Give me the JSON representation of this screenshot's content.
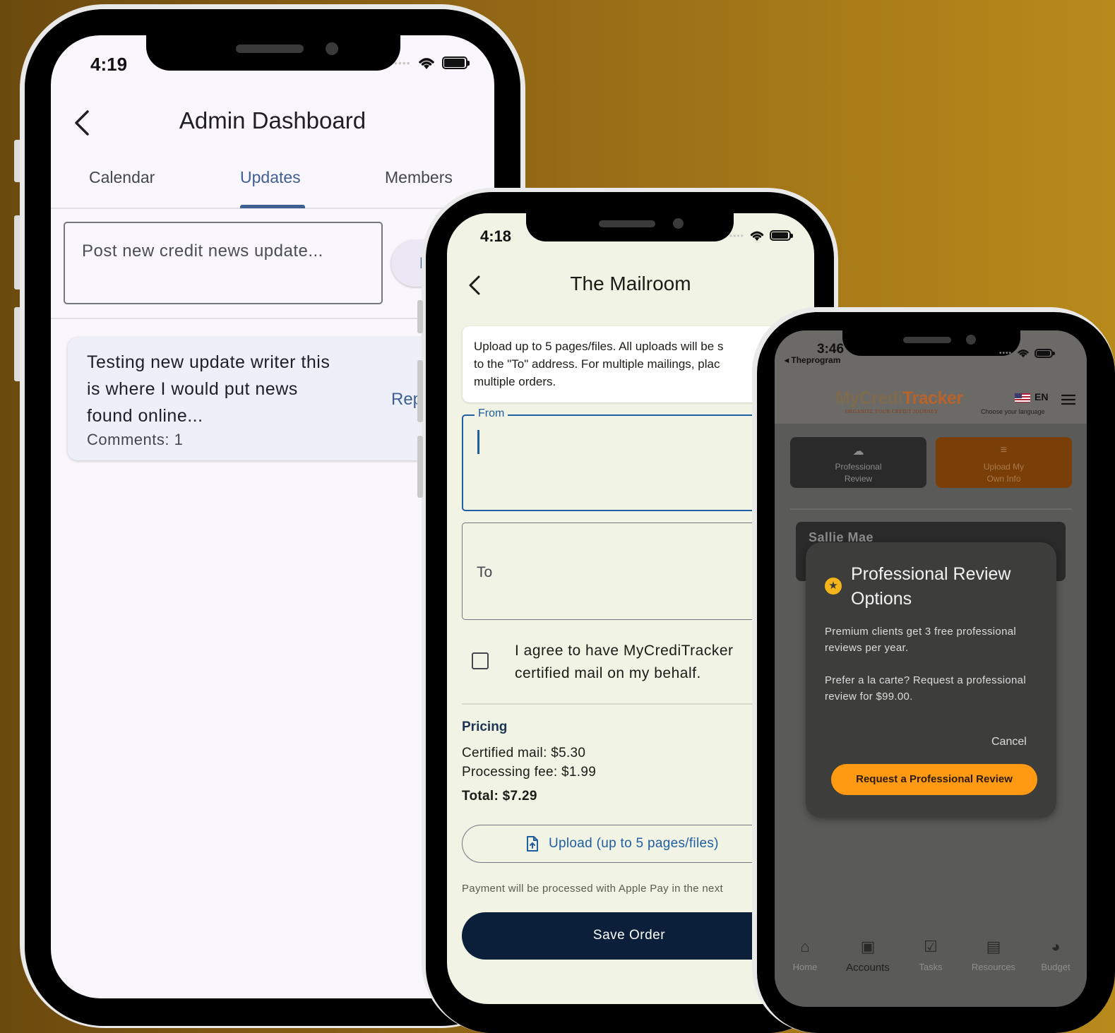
{
  "admin_phone": {
    "status_time": "4:19",
    "title": "Admin Dashboard",
    "tabs": [
      {
        "label": "Calendar",
        "active": false
      },
      {
        "label": "Updates",
        "active": true
      },
      {
        "label": "Members",
        "active": false
      }
    ],
    "post_input_placeholder": "Post new credit news update...",
    "post_button_label": "P",
    "update_card": {
      "text": "Testing new update writer this is where I would put news found online...",
      "comments": "Comments: 1",
      "reply_label": "Rep"
    }
  },
  "mailroom_phone": {
    "status_time": "4:18",
    "title": "The Mailroom",
    "info_text": "Upload up to 5 pages/files. All uploads will be s\nto the \"To\" address. For multiple mailings, plac\nmultiple orders.",
    "from_label": "From",
    "to_label": "To",
    "agree_text": "I agree to have MyCrediTracker certified mail on my behalf.",
    "agree_checked": false,
    "pricing_heading": "Pricing",
    "certified_mail": "Certified mail: $5.30",
    "processing_fee": "Processing fee: $1.99",
    "total": "Total: $7.29",
    "upload_button": "Upload (up to 5 pages/files)",
    "payment_note": "Payment will be processed with Apple Pay in the next",
    "save_button": "Save Order"
  },
  "creditracker_phone": {
    "status_time": "3:46",
    "back_app": "◂ Theprogram",
    "logo_part1": "MyCredi",
    "logo_part2": "Tracker",
    "tagline": "ORGANIZE YOUR CREDIT JOURNEY",
    "language_code": "EN",
    "language_caption": "Choose your language",
    "tiles": [
      {
        "label": "Professional\nReview",
        "icon": "cloud-upload-icon"
      },
      {
        "label": "Upload My\nOwn Info",
        "icon": "edit-list-icon"
      }
    ],
    "account_name": "Sallie Mae",
    "dialog": {
      "title": "Professional Review Options",
      "body1": "Premium clients get 3 free professional reviews per year.",
      "body2": "Prefer a la carte? Request a professional review for $99.00.",
      "cancel_label": "Cancel",
      "request_label": "Request a Professional Review"
    },
    "nav": [
      {
        "label": "Home",
        "icon": "home-icon",
        "active": false
      },
      {
        "label": "Accounts",
        "icon": "wallet-icon",
        "active": true
      },
      {
        "label": "Tasks",
        "icon": "checklist-icon",
        "active": false
      },
      {
        "label": "Resources",
        "icon": "book-icon",
        "active": false
      },
      {
        "label": "Budget",
        "icon": "pie-chart-icon",
        "active": false
      }
    ]
  },
  "colors": {
    "background_left": "#6b4a0e",
    "background_right": "#b88a1c",
    "admin_accent": "#3e5f92",
    "mailroom_navy": "#0b1f3a",
    "tracker_orange": "#ff9a12"
  }
}
